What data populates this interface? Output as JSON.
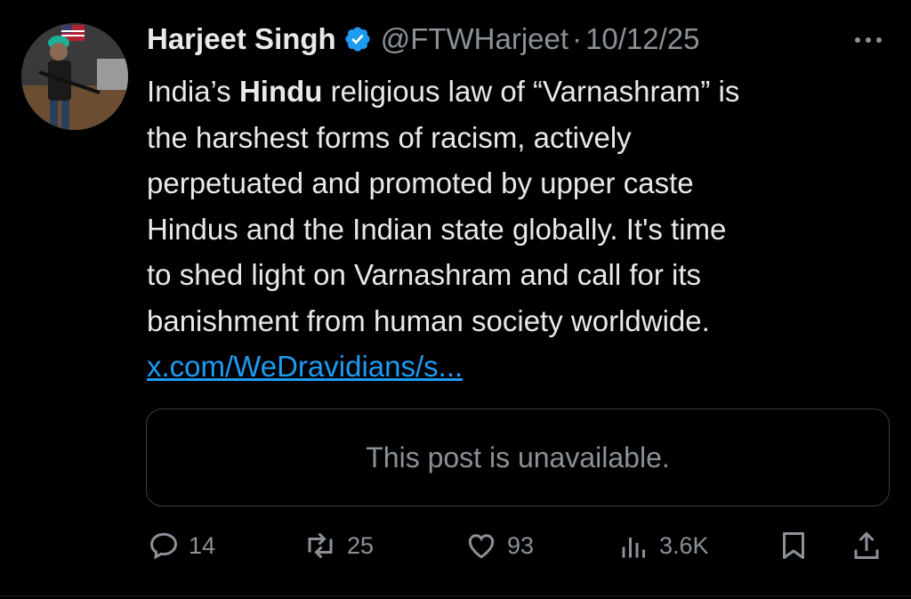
{
  "tweet": {
    "author_name": "Harjeet Singh",
    "handle": "@FTWHarjeet",
    "separator": "·",
    "date": "10/12/25",
    "text_lines": [
      [
        "India’s ",
        "Hindu",
        " religious law of “Varnashram” is"
      ],
      "the harshest forms of racism, actively",
      "perpetuated and promoted by upper caste",
      "Hindus and the Indian state globally. It's time",
      "to shed light on Varnashram and call for its",
      "banishment from human society worldwide."
    ],
    "link_text": "x.com/WeDravidians/s...",
    "quoted_post_text": "This post is unavailable."
  },
  "actions": {
    "replies": "14",
    "reposts": "25",
    "likes": "93",
    "views": "3.6K"
  },
  "icons": {
    "verified": "verified-badge-icon",
    "more": "more-dots-icon",
    "reply": "reply-icon",
    "repost": "repost-icon",
    "like": "heart-icon",
    "views": "views-icon",
    "bookmark": "bookmark-icon",
    "share": "share-icon"
  },
  "colors": {
    "background": "#000000",
    "text": "#e7e9ea",
    "secondary": "#8b9198",
    "link": "#1d9bf0",
    "border": "#3a3d41"
  }
}
